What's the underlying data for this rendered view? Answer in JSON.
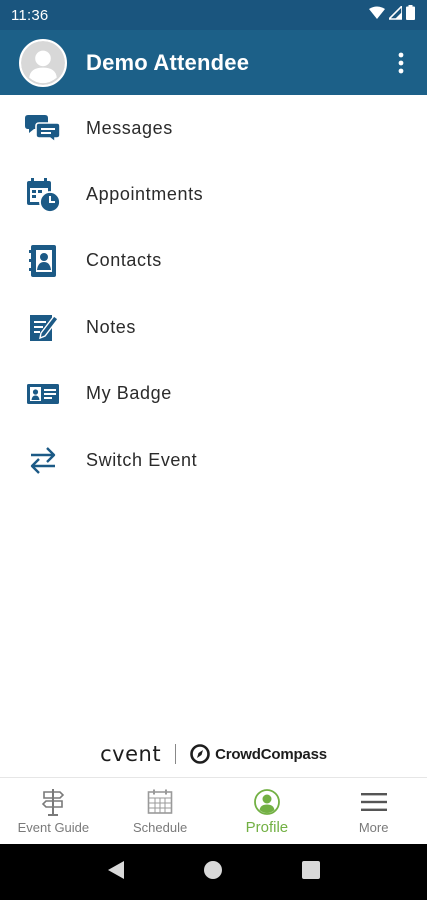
{
  "status_bar": {
    "time": "11:36",
    "icons": [
      "wifi-icon",
      "signal-icon",
      "battery-icon"
    ]
  },
  "header": {
    "user_name": "Demo Attendee",
    "avatar_icon": "default-avatar-icon",
    "overflow_icon": "more-vert-icon",
    "background_color": "#1c6088"
  },
  "menu": {
    "items": [
      {
        "label": "Messages",
        "icon": "chat-bubbles-icon"
      },
      {
        "label": "Appointments",
        "icon": "calendar-clock-icon"
      },
      {
        "label": "Contacts",
        "icon": "contact-book-icon"
      },
      {
        "label": "Notes",
        "icon": "note-edit-icon"
      },
      {
        "label": "My Badge",
        "icon": "id-badge-icon"
      },
      {
        "label": "Switch Event",
        "icon": "swap-arrows-icon"
      }
    ],
    "icon_color": "#1c5a86"
  },
  "branding": {
    "cvent": "cvent",
    "crowdcompass": "CrowdCompass"
  },
  "bottom_nav": {
    "tabs": [
      {
        "label": "Event Guide",
        "icon": "signpost-icon",
        "active": false
      },
      {
        "label": "Schedule",
        "icon": "schedule-grid-icon",
        "active": false
      },
      {
        "label": "Profile",
        "icon": "profile-icon",
        "active": true
      },
      {
        "label": "More",
        "icon": "hamburger-menu-icon",
        "active": false
      }
    ],
    "active_color": "#72b043",
    "inactive_color": "#7a7a7a"
  },
  "system_nav": {
    "buttons": [
      "back-icon",
      "home-icon",
      "recents-icon"
    ]
  }
}
